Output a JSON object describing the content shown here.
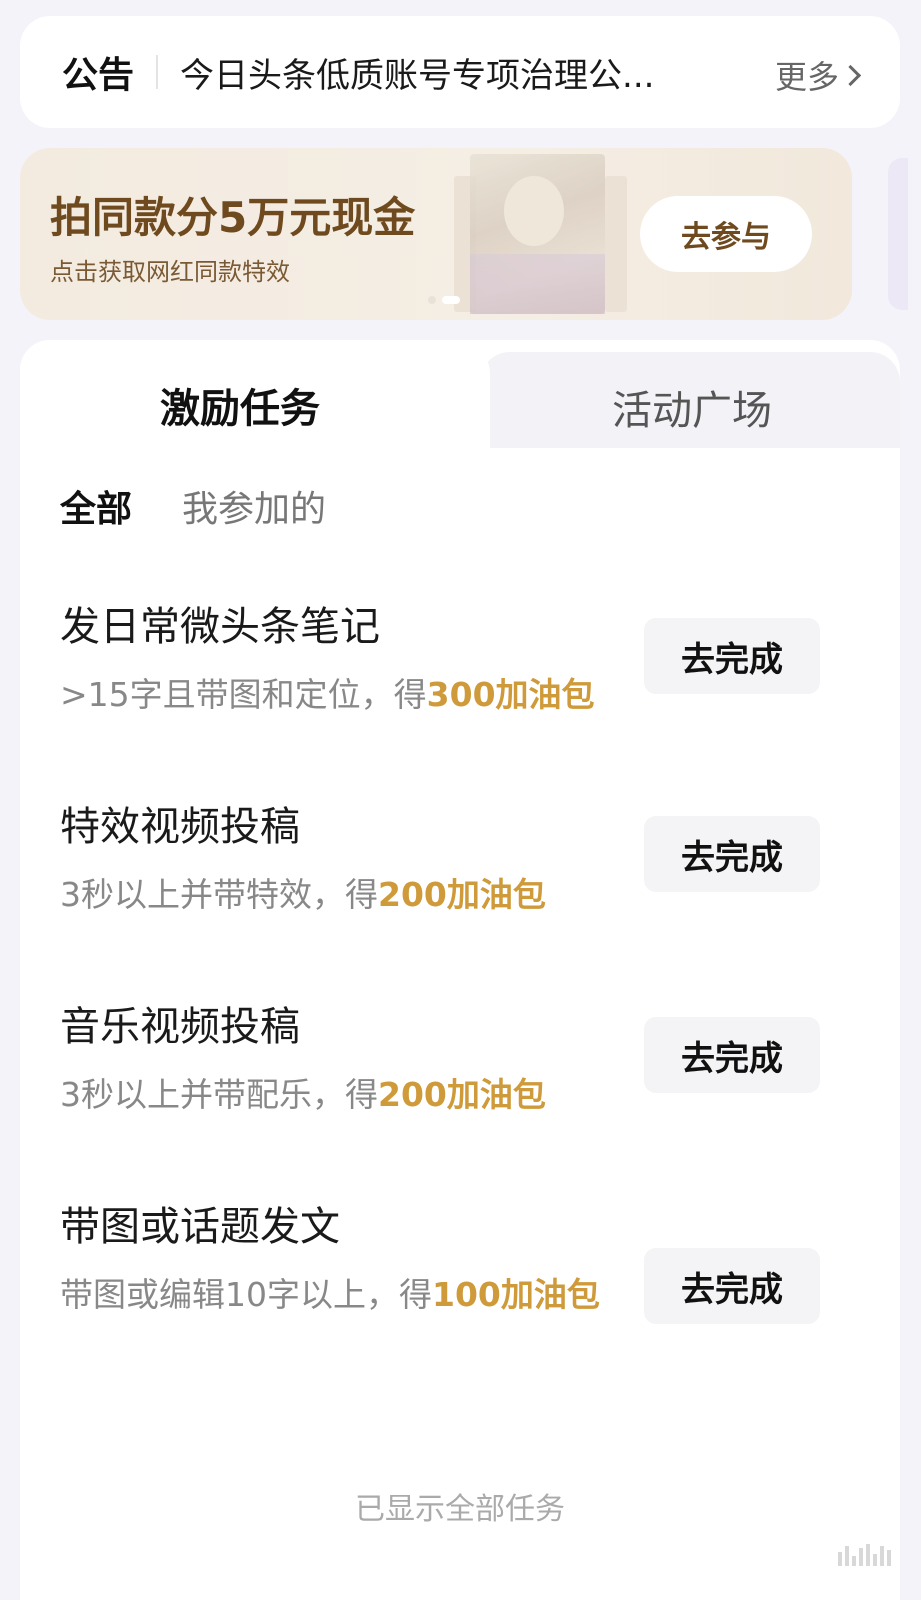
{
  "notice": {
    "label": "公告",
    "text": "今日头条低质账号专项治理公...",
    "more": "更多"
  },
  "banner": {
    "title": "拍同款分5万元现金",
    "subtitle": "点击获取网红同款特效",
    "button": "去参与"
  },
  "tabs": [
    {
      "label": "激励任务",
      "active": true
    },
    {
      "label": "活动广场",
      "active": false
    }
  ],
  "subtabs": [
    {
      "label": "全部",
      "active": true
    },
    {
      "label": "我参加的",
      "active": false
    }
  ],
  "tasks": [
    {
      "title": "发日常微头条笔记",
      "desc": ">15字且带图和定位，得",
      "reward": "300加油包",
      "button": "去完成"
    },
    {
      "title": "特效视频投稿",
      "desc": "3秒以上并带特效，得",
      "reward": "200加油包",
      "button": "去完成"
    },
    {
      "title": "音乐视频投稿",
      "desc": "3秒以上并带配乐，得",
      "reward": "200加油包",
      "button": "去完成"
    },
    {
      "title": "带图或话题发文",
      "desc": "带图或编辑10字以上，得",
      "reward": "100加油包",
      "button": "去完成"
    }
  ],
  "footer": "已显示全部任务",
  "colors": {
    "reward": "#cf9a3a",
    "banner_text": "#6e4a1e",
    "page_bg": "#f4f3fa"
  }
}
